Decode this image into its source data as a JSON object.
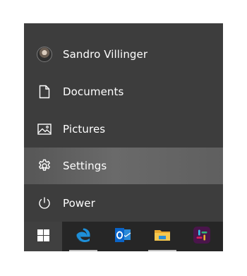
{
  "start_menu": {
    "items": [
      {
        "label": "Sandro Villinger",
        "icon": "user-avatar"
      },
      {
        "label": "Documents",
        "icon": "document-icon"
      },
      {
        "label": "Pictures",
        "icon": "picture-icon"
      },
      {
        "label": "Settings",
        "icon": "gear-icon",
        "highlighted": true
      },
      {
        "label": "Power",
        "icon": "power-icon"
      }
    ]
  },
  "taskbar": {
    "items": [
      {
        "name": "windows-start",
        "icon": "windows-logo-icon"
      },
      {
        "name": "edge",
        "icon": "edge-icon",
        "open": true
      },
      {
        "name": "outlook",
        "icon": "outlook-icon"
      },
      {
        "name": "file-explorer",
        "icon": "folder-icon",
        "open": true
      },
      {
        "name": "slack",
        "icon": "slack-icon"
      }
    ]
  },
  "colors": {
    "menu_bg": "#3d3d3d",
    "taskbar_bg": "#262626",
    "highlight": "#616161",
    "edge_blue": "#1e8fd8",
    "outlook_blue": "#0a64c8",
    "folder_yellow": "#f2c14e",
    "slack_purple": "#4a154b"
  }
}
